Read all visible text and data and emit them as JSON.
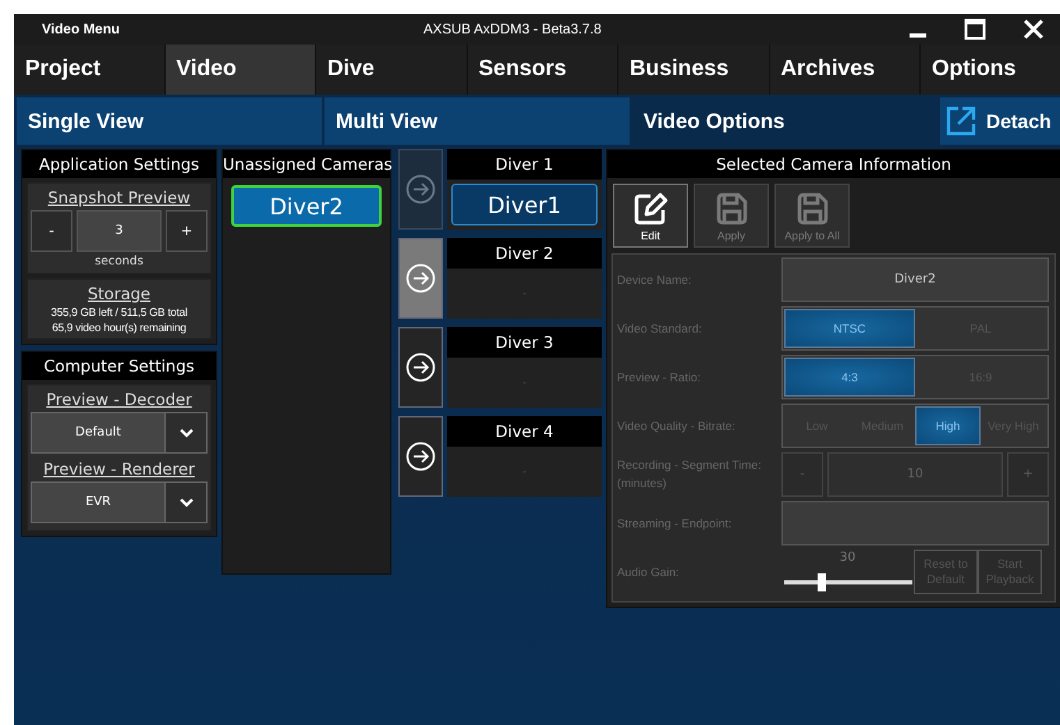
{
  "window": {
    "menu_label": "Video Menu",
    "title": "AXSUB AxDDM3 - Beta3.7.8"
  },
  "main_tabs": [
    {
      "label": "Project",
      "selected": false
    },
    {
      "label": "Video",
      "selected": true
    },
    {
      "label": "Dive",
      "selected": false
    },
    {
      "label": "Sensors",
      "selected": false
    },
    {
      "label": "Business",
      "selected": false
    },
    {
      "label": "Archives",
      "selected": false
    },
    {
      "label": "Options",
      "selected": false
    }
  ],
  "sub_tabs": [
    {
      "label": "Single View",
      "selected": false
    },
    {
      "label": "Multi View",
      "selected": false
    },
    {
      "label": "Video Options",
      "selected": true
    },
    {
      "label": "Detach",
      "selected": false,
      "kind": "detach"
    }
  ],
  "application_settings": {
    "title": "Application Settings",
    "snapshot_preview": {
      "label": "Snapshot Preview",
      "minus": "-",
      "value": "3",
      "plus": "+",
      "unit": "seconds"
    },
    "storage": {
      "label": "Storage",
      "space": "355,9 GB left / 511,5 GB total",
      "hours": "65,9  video hour(s) remaining"
    }
  },
  "computer_settings": {
    "title": "Computer Settings",
    "dropdowns": [
      {
        "label": "Preview - Decoder",
        "value": "Default"
      },
      {
        "label": "Preview - Renderer",
        "value": "EVR"
      }
    ]
  },
  "unassigned_cameras": {
    "title": "Unassigned Cameras",
    "cameras": [
      {
        "name": "Diver2",
        "selected": true
      }
    ]
  },
  "diver_slots": [
    {
      "title": "Diver 1",
      "camera": "Diver1",
      "arrow_disabled": true,
      "selected": false
    },
    {
      "title": "Diver 2",
      "camera": "-",
      "arrow_disabled": false,
      "selected": true
    },
    {
      "title": "Diver 3",
      "camera": "-",
      "arrow_disabled": false,
      "selected": false
    },
    {
      "title": "Diver 4",
      "camera": "-",
      "arrow_disabled": false,
      "selected": false
    }
  ],
  "camera_info": {
    "title": "Selected Camera Information",
    "toolbar": [
      {
        "label": "Edit",
        "kind": "edit",
        "disabled": false
      },
      {
        "label": "Apply",
        "kind": "save",
        "disabled": true
      },
      {
        "label": "Apply to All",
        "kind": "save",
        "disabled": true
      }
    ],
    "rows": [
      {
        "kind": "field",
        "label": "Device Name:",
        "value": "Diver2"
      },
      {
        "kind": "segmented",
        "label": "Video Standard:",
        "options": [
          {
            "label": "NTSC",
            "selected": true
          },
          {
            "label": "PAL",
            "selected": false
          }
        ]
      },
      {
        "kind": "segmented",
        "label": "Preview - Ratio:",
        "options": [
          {
            "label": "4:3",
            "selected": true
          },
          {
            "label": "16:9",
            "selected": false
          }
        ]
      },
      {
        "kind": "segmented",
        "label": "Video Quality - Bitrate:",
        "options": [
          {
            "label": "Low",
            "selected": false
          },
          {
            "label": "Medium",
            "selected": false
          },
          {
            "label": "High",
            "selected": true
          },
          {
            "label": "Very High",
            "selected": false
          }
        ]
      },
      {
        "kind": "stepper",
        "label": "Recording - Segment Time: (minutes)",
        "minus": "-",
        "value": "10",
        "plus": "+"
      },
      {
        "kind": "field",
        "label": "Streaming - Endpoint:"
      },
      {
        "kind": "slider",
        "label": "Audio Gain:",
        "reading": "30",
        "level": 0.3,
        "buttons": [
          "Reset to Default",
          "Start Playback"
        ]
      }
    ]
  }
}
